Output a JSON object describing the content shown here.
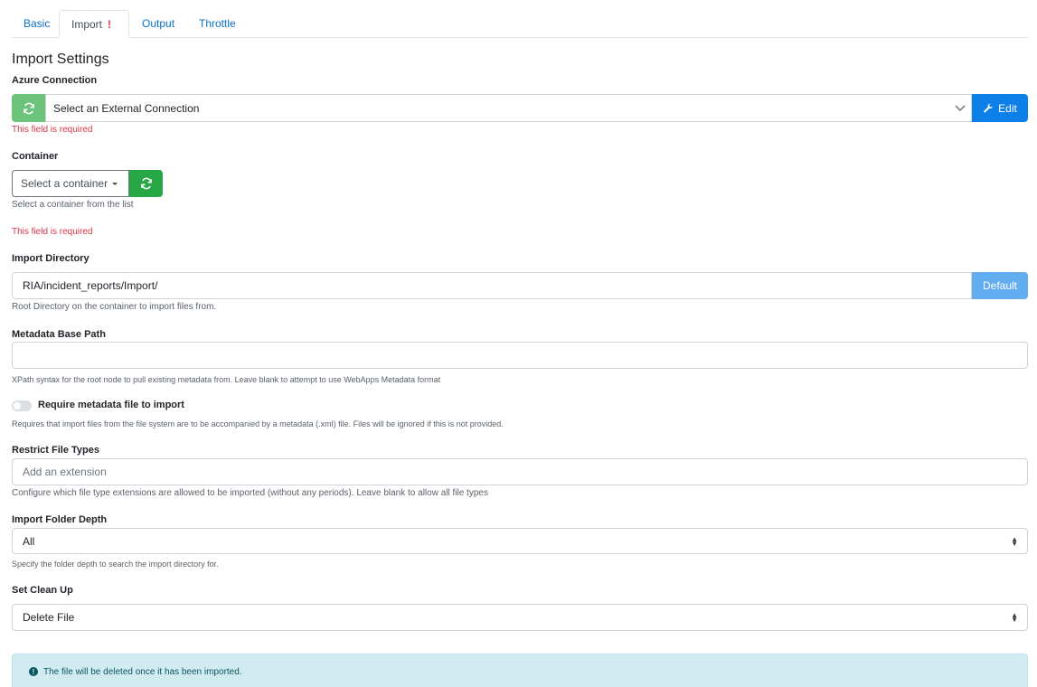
{
  "tabs": [
    {
      "label": "Basic"
    },
    {
      "label": "Import",
      "alert": "!"
    },
    {
      "label": "Output"
    },
    {
      "label": "Throttle"
    }
  ],
  "section_title": "Import Settings",
  "azure": {
    "label": "Azure Connection",
    "value": "Select an External Connection",
    "edit_label": "Edit",
    "error": "This field is required"
  },
  "container": {
    "label": "Container",
    "dropdown_label": "Select a container",
    "help": "Select a container from the list",
    "error": "This field is required"
  },
  "import_directory": {
    "label": "Import Directory",
    "value": "RIA/incident_reports/Import/",
    "default_label": "Default",
    "help": "Root Directory on the container to import files from."
  },
  "metadata_base_path": {
    "label": "Metadata Base Path",
    "value": "",
    "help": "XPath syntax for the root node to pull existing metadata from. Leave blank to attempt to use WebApps Metadata format"
  },
  "require_metadata": {
    "label": "Require metadata file to import",
    "enabled": false,
    "help": "Requires that import files from the file system are to be accompanied by a metadata (.xml) file. Files will be ignored if this is not provided."
  },
  "restrict_file_types": {
    "label": "Restrict File Types",
    "placeholder": "Add an extension",
    "help": "Configure which file type extensions are allowed to be imported (without any periods). Leave blank to allow all file types"
  },
  "import_folder_depth": {
    "label": "Import Folder Depth",
    "value": "All",
    "help": "Specify the folder depth to search the import directory for."
  },
  "clean_up": {
    "label": "Set Clean Up",
    "value": "Delete File"
  },
  "info": {
    "icon": "info-circle-icon",
    "text": "The file will be deleted once it has been imported."
  },
  "colors": {
    "primary": "#0d7fe8",
    "success": "#28a745",
    "danger": "#dc3545",
    "info_bg": "#d1ecf1"
  }
}
